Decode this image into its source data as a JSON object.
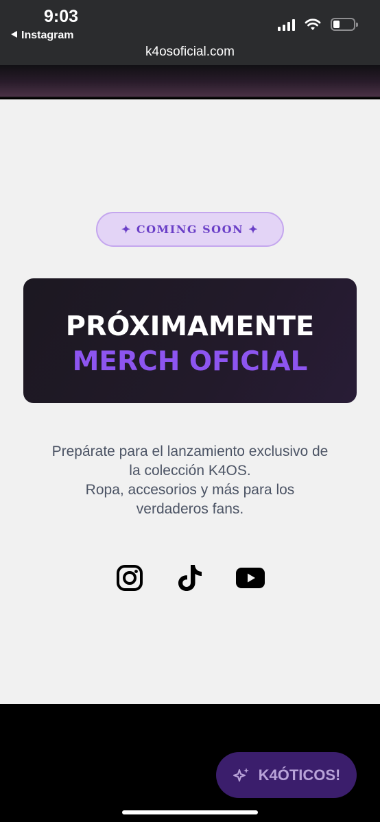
{
  "status_bar": {
    "time": "9:03",
    "back_app": "Instagram",
    "url": "k4osoficial.com"
  },
  "main": {
    "badge": "✦ COMING SOON ✦",
    "hero_title": "PRÓXIMAMENTE",
    "hero_subtitle": "MERCH OFICIAL",
    "description": [
      "Prepárate para el lanzamiento exclusivo de",
      "la colección K4OS.",
      "Ropa, accesorios y más para los",
      "verdaderos fans."
    ],
    "socials": [
      {
        "icon": "instagram-icon"
      },
      {
        "icon": "tiktok-icon"
      },
      {
        "icon": "youtube-icon"
      }
    ]
  },
  "fab": {
    "label": "K4ÓTICOS!",
    "icon": "sparkles-icon"
  },
  "colors": {
    "accent": "#8d55f0",
    "badge_bg": "#e3d4f6",
    "fab_bg": "#3b1e6c",
    "page_bg": "#f1f1f1"
  }
}
